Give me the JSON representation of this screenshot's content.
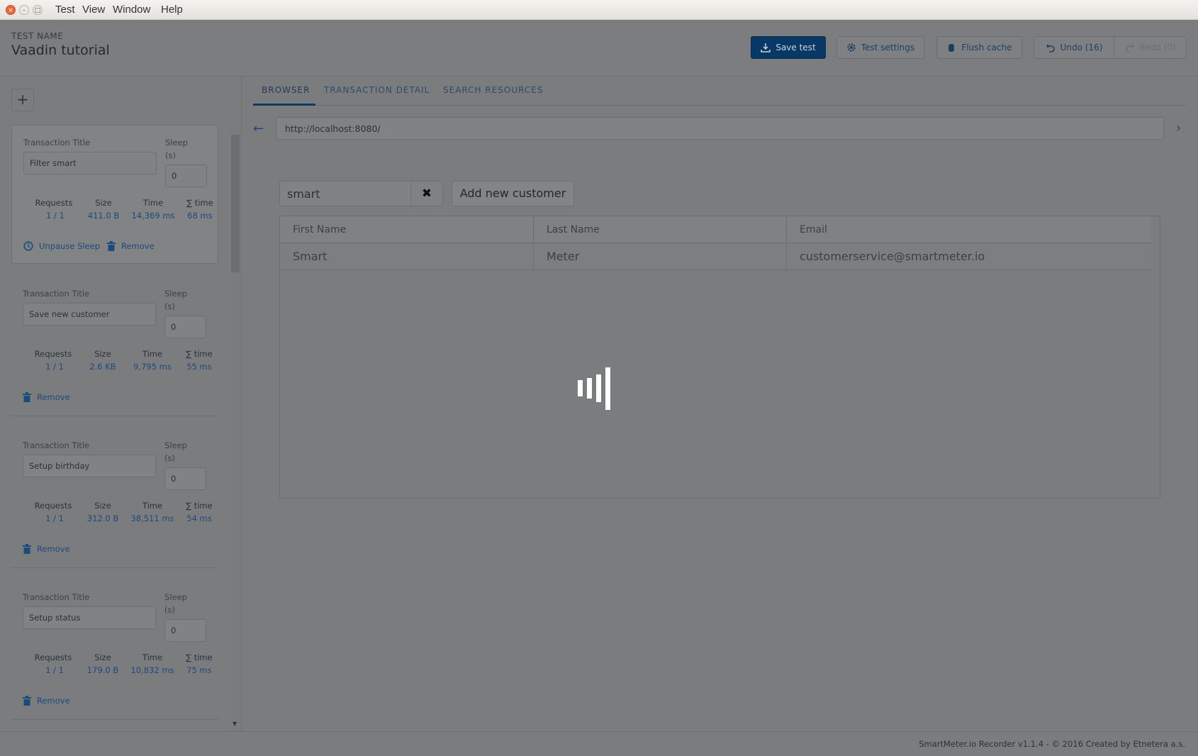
{
  "window": {
    "menu": [
      "Test",
      "View",
      "Window",
      "Help"
    ]
  },
  "header": {
    "test_name_label": "TEST NAME",
    "test_name": "Vaadin tutorial",
    "buttons": {
      "save": "Save test",
      "settings": "Test settings",
      "flush": "Flush cache",
      "undo": "Undo (16)",
      "redo": "Redo (0)"
    }
  },
  "sidebar": {
    "add_label": "+",
    "transactions": [
      {
        "title_label": "Transaction Title",
        "title": "Filter smart",
        "sleep_label": "Sleep",
        "sleep_unit": "(s)",
        "sleep": "0",
        "headers": [
          "Requests",
          "Size",
          "Time",
          "∑ time"
        ],
        "values": [
          "1 / 1",
          "411.0 B",
          "14,369 ms",
          "68 ms"
        ],
        "actions": [
          "Unpause Sleep",
          "Remove"
        ],
        "selected": true
      },
      {
        "title_label": "Transaction Title",
        "title": "Save new customer",
        "sleep_label": "Sleep",
        "sleep_unit": "(s)",
        "sleep": "0",
        "headers": [
          "Requests",
          "Size",
          "Time",
          "∑ time"
        ],
        "values": [
          "1 / 1",
          "2.6 KB",
          "9,795 ms",
          "55 ms"
        ],
        "actions": [
          "Remove"
        ]
      },
      {
        "title_label": "Transaction Title",
        "title": "Setup birthday",
        "sleep_label": "Sleep",
        "sleep_unit": "(s)",
        "sleep": "0",
        "headers": [
          "Requests",
          "Size",
          "Time",
          "∑ time"
        ],
        "values": [
          "1 / 1",
          "312.0 B",
          "38,511 ms",
          "54 ms"
        ],
        "actions": [
          "Remove"
        ]
      },
      {
        "title_label": "Transaction Title",
        "title": "Setup status",
        "sleep_label": "Sleep",
        "sleep_unit": "(s)",
        "sleep": "0",
        "headers": [
          "Requests",
          "Size",
          "Time",
          "∑ time"
        ],
        "values": [
          "1 / 1",
          "179.0 B",
          "10,832 ms",
          "75 ms"
        ],
        "actions": [
          "Remove"
        ]
      }
    ]
  },
  "main": {
    "tabs": [
      "BROWSER",
      "TRANSACTION DETAIL",
      "SEARCH RESOURCES"
    ],
    "active_tab": 0,
    "url": "http://localhost:8080/",
    "app": {
      "filter": "smart",
      "add_button": "Add new customer",
      "columns": [
        "First Name",
        "Last Name",
        "Email"
      ],
      "rows": [
        [
          "Smart",
          "Meter",
          "customerservice@smartmeter.io"
        ]
      ]
    }
  },
  "footer": {
    "text": "SmartMeter.io Recorder v1.1.4 - © 2016 Created by Etnetera a.s."
  },
  "colors": {
    "accent": "#0a3866",
    "link": "#1d4a7c"
  }
}
